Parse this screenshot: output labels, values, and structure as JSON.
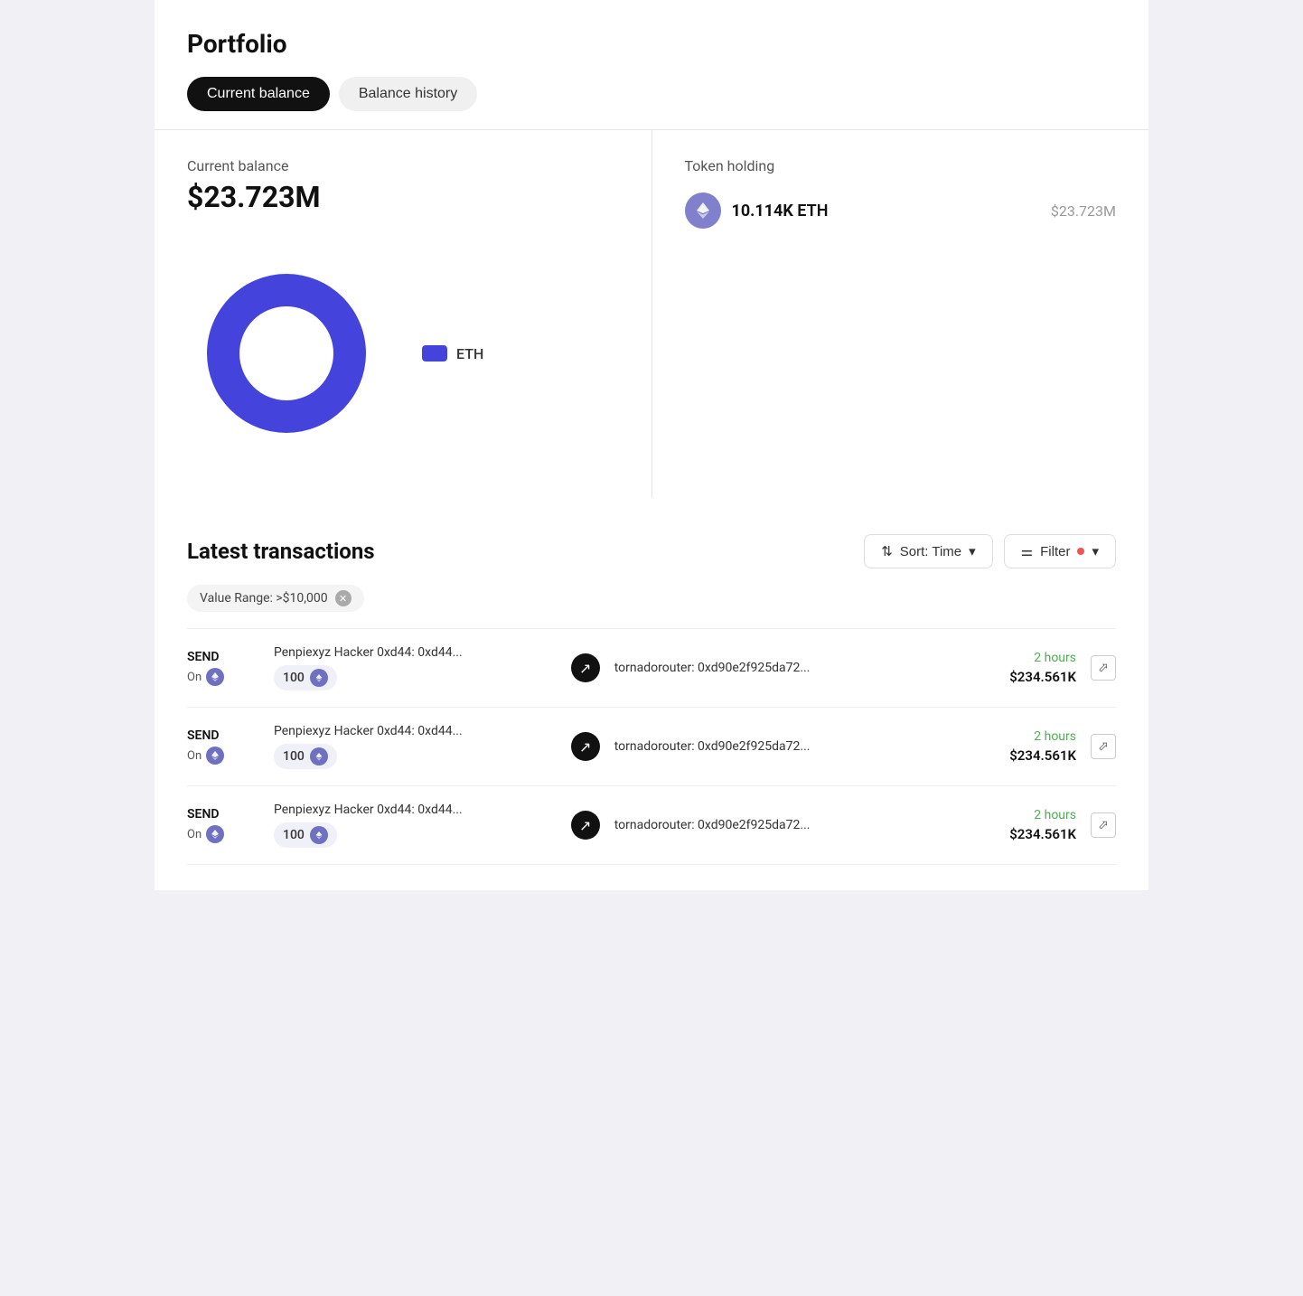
{
  "page": {
    "title": "Portfolio"
  },
  "tabs": [
    {
      "id": "current-balance",
      "label": "Current balance",
      "active": true
    },
    {
      "id": "balance-history",
      "label": "Balance history",
      "active": false
    }
  ],
  "balance": {
    "label": "Current balance",
    "amount": "$23.723M"
  },
  "chart": {
    "legend_label": "ETH",
    "donut_color": "#4444dd",
    "donut_inner": "#fff"
  },
  "token_holding": {
    "title": "Token holding",
    "token_amount": "10.114K",
    "token_symbol": "ETH",
    "token_value": "$23.723M"
  },
  "transactions": {
    "title": "Latest transactions",
    "sort_label": "Sort: Time",
    "filter_label": "Filter",
    "filter_tag": "Value Range: >$10,000",
    "rows": [
      {
        "type": "SEND",
        "on_label": "On",
        "from": "Penpiexyz Hacker 0xd44: 0xd44...",
        "amount": "100",
        "to": "tornadorouter: 0xd90e2f925da72...",
        "time": "2 hours",
        "usd": "$234.561K"
      },
      {
        "type": "SEND",
        "on_label": "On",
        "from": "Penpiexyz Hacker 0xd44: 0xd44...",
        "amount": "100",
        "to": "tornadorouter: 0xd90e2f925da72...",
        "time": "2 hours",
        "usd": "$234.561K"
      },
      {
        "type": "SEND",
        "on_label": "On",
        "from": "Penpiexyz Hacker 0xd44: 0xd44...",
        "amount": "100",
        "to": "tornadorouter: 0xd90e2f925da72...",
        "time": "2 hours",
        "usd": "$234.561K"
      }
    ]
  },
  "icons": {
    "eth_symbol": "⬡",
    "arrow_symbol": "↗",
    "close_symbol": "✕",
    "sort_symbol": "⇅",
    "filter_symbol": "⚌",
    "external_link": "⬀"
  }
}
